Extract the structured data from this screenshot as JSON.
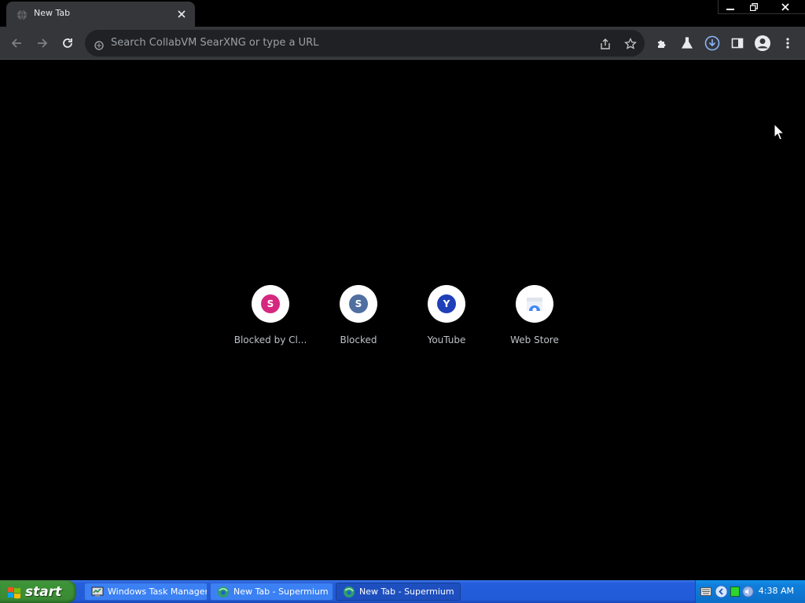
{
  "tab": {
    "title": "New Tab"
  },
  "omnibox": {
    "placeholder": "Search CollabVM SearXNG or type a URL"
  },
  "shortcuts": [
    {
      "letter": "S",
      "label": "Blocked by Cl...",
      "color": "#d6277f"
    },
    {
      "letter": "S",
      "label": "Blocked",
      "color": "#4f6fa0"
    },
    {
      "letter": "Y",
      "label": "YouTube",
      "color": "#1f3fb8"
    },
    {
      "letter": "",
      "label": "Web Store",
      "color": "#4285f4"
    }
  ],
  "taskbar": {
    "start_label": "start",
    "tasks": [
      {
        "label": "Windows Task Manager",
        "active": false
      },
      {
        "label": "New Tab - Supermium",
        "active": false
      },
      {
        "label": "New Tab - Supermium",
        "active": true
      }
    ],
    "clock": "4:38 AM"
  },
  "colors": {
    "accent": "#8ab4f8",
    "toolbar": "#35363a",
    "omnibox": "#202124"
  }
}
